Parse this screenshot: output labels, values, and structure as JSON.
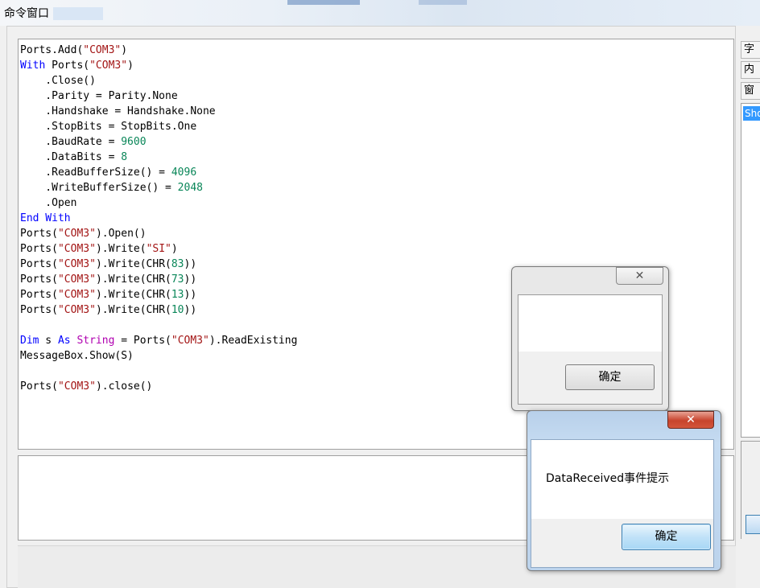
{
  "window": {
    "title": "命令窗口"
  },
  "editor": {
    "lines": [
      [
        {
          "t": "Ports.Add(",
          "c": "plain"
        },
        {
          "t": "\"COM3\"",
          "c": "str"
        },
        {
          "t": ")",
          "c": "plain"
        }
      ],
      [
        {
          "t": "With",
          "c": "kw"
        },
        {
          "t": " Ports(",
          "c": "plain"
        },
        {
          "t": "\"COM3\"",
          "c": "str"
        },
        {
          "t": ")",
          "c": "plain"
        }
      ],
      [
        {
          "t": "    .Close()",
          "c": "plain"
        }
      ],
      [
        {
          "t": "    .Parity = Parity.None",
          "c": "plain"
        }
      ],
      [
        {
          "t": "    .Handshake = Handshake.None",
          "c": "plain"
        }
      ],
      [
        {
          "t": "    .StopBits = StopBits.One",
          "c": "plain"
        }
      ],
      [
        {
          "t": "    .BaudRate = ",
          "c": "plain"
        },
        {
          "t": "9600",
          "c": "num"
        }
      ],
      [
        {
          "t": "    .DataBits = ",
          "c": "plain"
        },
        {
          "t": "8",
          "c": "num"
        }
      ],
      [
        {
          "t": "    .ReadBufferSize() = ",
          "c": "plain"
        },
        {
          "t": "4096",
          "c": "num"
        }
      ],
      [
        {
          "t": "    .WriteBufferSize() = ",
          "c": "plain"
        },
        {
          "t": "2048",
          "c": "num"
        }
      ],
      [
        {
          "t": "    .Open",
          "c": "plain"
        }
      ],
      [
        {
          "t": "End With",
          "c": "kw"
        }
      ],
      [
        {
          "t": "Ports(",
          "c": "plain"
        },
        {
          "t": "\"COM3\"",
          "c": "str"
        },
        {
          "t": ").Open()",
          "c": "plain"
        }
      ],
      [
        {
          "t": "Ports(",
          "c": "plain"
        },
        {
          "t": "\"COM3\"",
          "c": "str"
        },
        {
          "t": ").Write(",
          "c": "plain"
        },
        {
          "t": "\"SI\"",
          "c": "str"
        },
        {
          "t": ")",
          "c": "plain"
        }
      ],
      [
        {
          "t": "Ports(",
          "c": "plain"
        },
        {
          "t": "\"COM3\"",
          "c": "str"
        },
        {
          "t": ").Write(CHR(",
          "c": "plain"
        },
        {
          "t": "83",
          "c": "num"
        },
        {
          "t": "))",
          "c": "plain"
        }
      ],
      [
        {
          "t": "Ports(",
          "c": "plain"
        },
        {
          "t": "\"COM3\"",
          "c": "str"
        },
        {
          "t": ").Write(CHR(",
          "c": "plain"
        },
        {
          "t": "73",
          "c": "num"
        },
        {
          "t": "))",
          "c": "plain"
        }
      ],
      [
        {
          "t": "Ports(",
          "c": "plain"
        },
        {
          "t": "\"COM3\"",
          "c": "str"
        },
        {
          "t": ").Write(CHR(",
          "c": "plain"
        },
        {
          "t": "13",
          "c": "num"
        },
        {
          "t": "))",
          "c": "plain"
        }
      ],
      [
        {
          "t": "Ports(",
          "c": "plain"
        },
        {
          "t": "\"COM3\"",
          "c": "str"
        },
        {
          "t": ").Write(CHR(",
          "c": "plain"
        },
        {
          "t": "10",
          "c": "num"
        },
        {
          "t": "))",
          "c": "plain"
        }
      ],
      [],
      [
        {
          "t": "Dim",
          "c": "kw"
        },
        {
          "t": " s ",
          "c": "plain"
        },
        {
          "t": "As",
          "c": "kw"
        },
        {
          "t": " ",
          "c": "plain"
        },
        {
          "t": "String",
          "c": "typ"
        },
        {
          "t": " = Ports(",
          "c": "plain"
        },
        {
          "t": "\"COM3\"",
          "c": "str"
        },
        {
          "t": ").ReadExisting",
          "c": "plain"
        }
      ],
      [
        {
          "t": "MessageBox.Show(S)",
          "c": "plain"
        }
      ],
      [],
      [
        {
          "t": "Ports(",
          "c": "plain"
        },
        {
          "t": "\"COM3\"",
          "c": "str"
        },
        {
          "t": ").close()",
          "c": "plain"
        }
      ]
    ]
  },
  "side_panel": {
    "tabs": [
      "字",
      "内",
      "窗"
    ],
    "list_item": "Sho"
  },
  "dialog_blank": {
    "close_glyph": "✕",
    "ok_label": "确定"
  },
  "dialog_msg": {
    "close_glyph": "✕",
    "message": "DataReceived事件提示",
    "ok_label": "确定"
  }
}
